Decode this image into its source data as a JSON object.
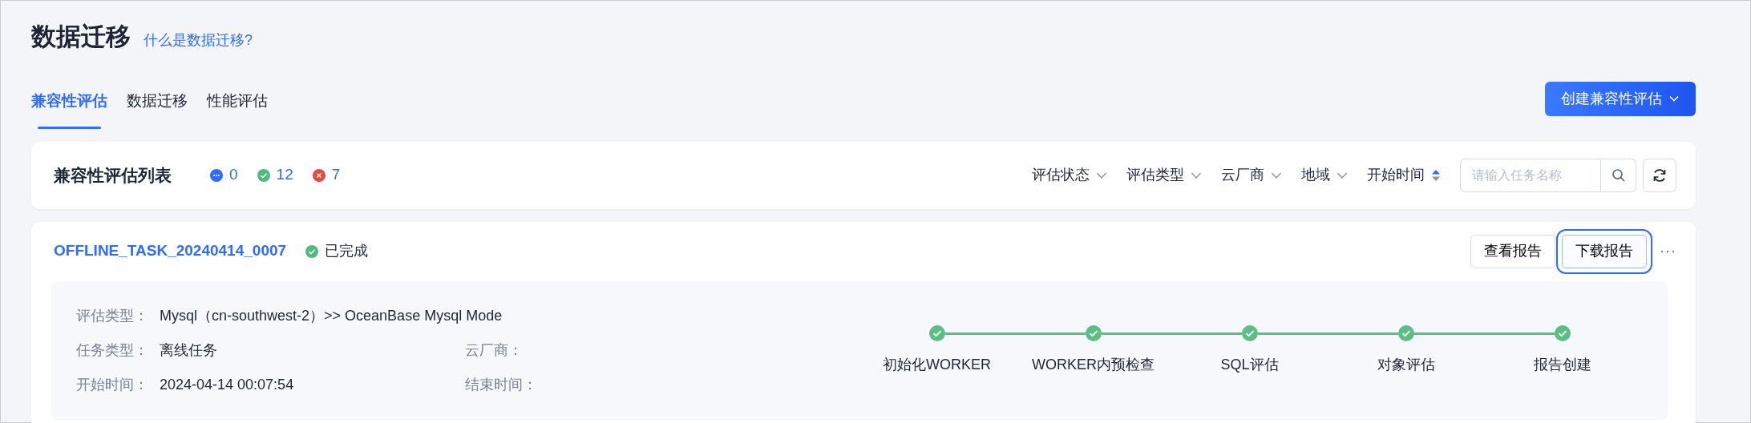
{
  "page": {
    "title": "数据迁移",
    "help_link": "什么是数据迁移?"
  },
  "tabs": [
    {
      "label": "兼容性评估",
      "selected": true
    },
    {
      "label": "数据迁移",
      "selected": false
    },
    {
      "label": "性能评估",
      "selected": false
    }
  ],
  "create_button": {
    "label": "创建兼容性评估"
  },
  "list_header": {
    "title": "兼容性评估列表",
    "status_counts": [
      {
        "kind": "running",
        "count": "0",
        "color": "#2f6bff"
      },
      {
        "kind": "success",
        "count": "12",
        "color": "#52b983"
      },
      {
        "kind": "failed",
        "count": "7",
        "color": "#e5483f"
      }
    ]
  },
  "filters": [
    {
      "label": "评估状态",
      "kind": "dropdown"
    },
    {
      "label": "评估类型",
      "kind": "dropdown"
    },
    {
      "label": "云厂商",
      "kind": "dropdown"
    },
    {
      "label": "地域",
      "kind": "dropdown"
    },
    {
      "label": "开始时间",
      "kind": "sort",
      "sort_ascending": true
    }
  ],
  "search": {
    "placeholder": "请输入任务名称"
  },
  "task": {
    "name": "OFFLINE_TASK_20240414_0007",
    "status": {
      "label": "已完成",
      "kind": "success"
    },
    "actions": [
      {
        "label": "查看报告",
        "focused": false
      },
      {
        "label": "下载报告",
        "focused": true
      }
    ],
    "more_label": "···",
    "detail_rows": [
      [
        {
          "label": "评估类型：",
          "value": "Mysql（cn-southwest-2）>> OceanBase Mysql Mode"
        }
      ],
      [
        {
          "label": "任务类型：",
          "value": "离线任务"
        },
        {
          "label": "云厂商："
        }
      ],
      [
        {
          "label": "开始时间：",
          "value": "2024-04-14 00:07:54"
        },
        {
          "label": "结束时间："
        }
      ]
    ],
    "steps": [
      {
        "label": "初始化WORKER",
        "done": true
      },
      {
        "label": "WORKER内预检查",
        "done": true
      },
      {
        "label": "SQL评估",
        "done": true
      },
      {
        "label": "对象评估",
        "done": true
      },
      {
        "label": "报告创建",
        "done": true
      }
    ]
  }
}
